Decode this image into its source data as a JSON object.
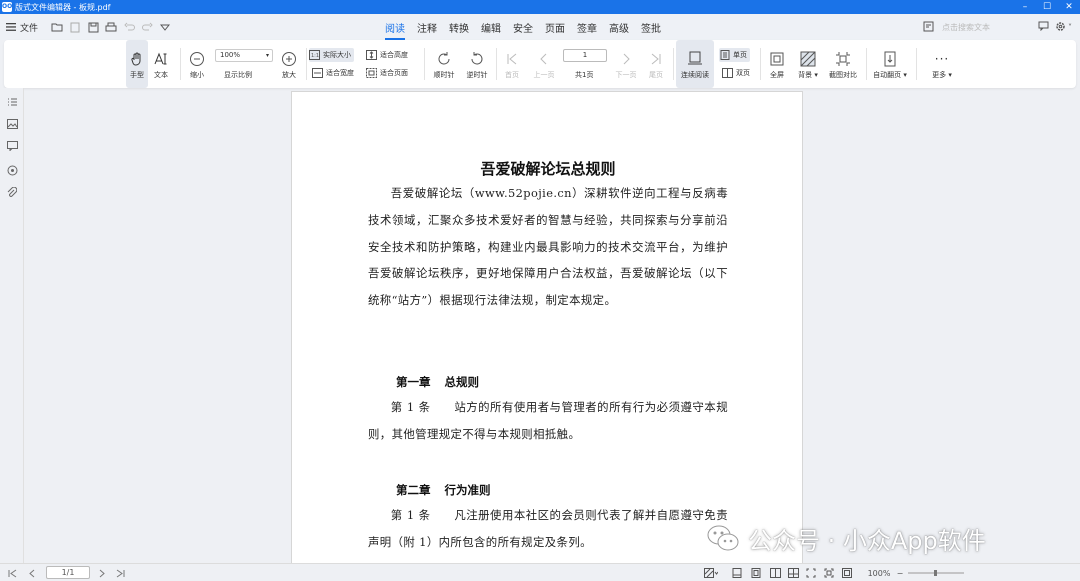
{
  "window": {
    "title": "版式文件编辑器 - 板规.pdf",
    "app_icon": "OO"
  },
  "menubar": {
    "file_label": "文件",
    "tabs": [
      "阅读",
      "注释",
      "转换",
      "编辑",
      "安全",
      "页面",
      "签章",
      "高级",
      "签批"
    ],
    "active_tab": "阅读",
    "search_placeholder": "点击搜索文本"
  },
  "toolbar": {
    "hand": "手型",
    "text": "文本",
    "zoom_out": "缩小",
    "zoom_value": "100%",
    "zoom_ratio": "显示比例",
    "zoom_in": "放大",
    "actual_size": "实际大小",
    "fit_height": "适合高度",
    "fit_width": "适合宽度",
    "fit_page": "适合页面",
    "rotate_cw": "顺时针",
    "rotate_ccw": "逆时针",
    "first_page": "首页",
    "prev_page": "上一页",
    "page_value": "1",
    "total_pages": "共1页",
    "next_page": "下一页",
    "last_page": "尾页",
    "continuous": "连续阅读",
    "single_page": "单页",
    "double_page": "双页",
    "fullscreen": "全屏",
    "background": "背景",
    "compare": "截图对比",
    "auto_scroll": "自动翻页",
    "more": "更多"
  },
  "document": {
    "title": "吾爱破解论坛总规则",
    "intro": "吾爱破解论坛（www.52pojie.cn）深耕软件逆向工程与反病毒技术领域，汇聚众多技术爱好者的智慧与经验，共同探索与分享前沿安全技术和防护策略，构建业内最具影响力的技术交流平台，为维护吾爱破解论坛秩序，更好地保障用户合法权益，吾爱破解论坛（以下统称“站方”）根据现行法律法规，制定本规定。",
    "chapter1_num": "第一章",
    "chapter1_title": "总规则",
    "chapter1_article": "第 1 条　　站方的所有使用者与管理者的所有行为必须遵守本规则，其他管理规定不得与本规则相抵触。",
    "chapter2_num": "第二章",
    "chapter2_title": "行为准则",
    "chapter2_article": "第 1 条　　凡注册使用本社区的会员则代表了解并自愿遵守免责声明（附 1）内所包含的所有规定及条列。"
  },
  "statusbar": {
    "page_indicator": "1/1",
    "zoom": "100%"
  },
  "watermark": {
    "text": "公众号 · 小众App软件"
  },
  "colors": {
    "accent": "#1a73e8",
    "titlebar": "#1a73e8",
    "background": "#eef0f4"
  }
}
